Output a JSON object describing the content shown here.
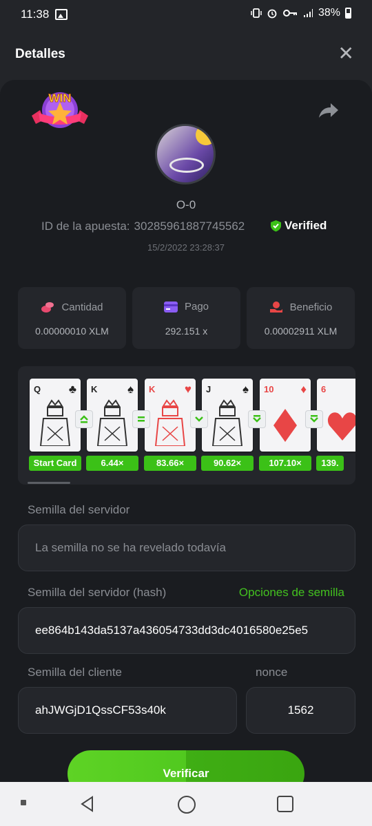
{
  "status_bar": {
    "time": "11:38",
    "battery": "38%"
  },
  "header": {
    "title": "Detalles"
  },
  "bet": {
    "username": "O-0",
    "id_label": "ID de la apuesta:",
    "id_value": "302859618877455​62",
    "verified_label": "Verified",
    "date": "15/2/2022 23:28:37",
    "badge_text": "WIN"
  },
  "stats": [
    {
      "label": "Cantidad",
      "value": "0.00000010 XLM",
      "icon": "coins-icon",
      "color": "#e84a6f"
    },
    {
      "label": "Pago",
      "value": "292.151 x",
      "icon": "card-icon",
      "color": "#8a5cf2"
    },
    {
      "label": "Beneficio",
      "value": "0.00002911 XLM",
      "icon": "hand-coin-icon",
      "color": "#e84646"
    }
  ],
  "cards": [
    {
      "rank": "Q",
      "suit": "♣",
      "red": false,
      "mult": "Start Card"
    },
    {
      "rank": "K",
      "suit": "♠",
      "red": false,
      "mult": "6.44×",
      "arrow": "up"
    },
    {
      "rank": "K",
      "suit": "♥",
      "red": true,
      "mult": "83.66×",
      "arrow": "equal"
    },
    {
      "rank": "J",
      "suit": "♠",
      "red": false,
      "mult": "90.62×",
      "arrow": "down"
    },
    {
      "rank": "10",
      "suit": "♦",
      "red": true,
      "mult": "107.10×",
      "arrow": "double-down"
    },
    {
      "rank": "6",
      "suit": "♥",
      "red": true,
      "mult": "139.",
      "arrow": "double-down"
    }
  ],
  "seeds": {
    "server_label": "Semilla del servidor",
    "server_value": "La semilla no se ha revelado todavía",
    "hash_label": "Semilla del servidor (hash)",
    "options_label": "Opciones de semilla",
    "hash_value": "ee864b143da5137a436054733dd3dc4016580e25e5",
    "client_label": "Semilla del cliente",
    "client_value": "ahJWGjD1QssCF53s40k",
    "nonce_label": "nonce",
    "nonce_value": "1562"
  },
  "actions": {
    "verify_label": "Verificar"
  },
  "colors": {
    "accent_green": "#43c11f",
    "panel": "#1a1c20",
    "card_bg": "#24262b"
  }
}
